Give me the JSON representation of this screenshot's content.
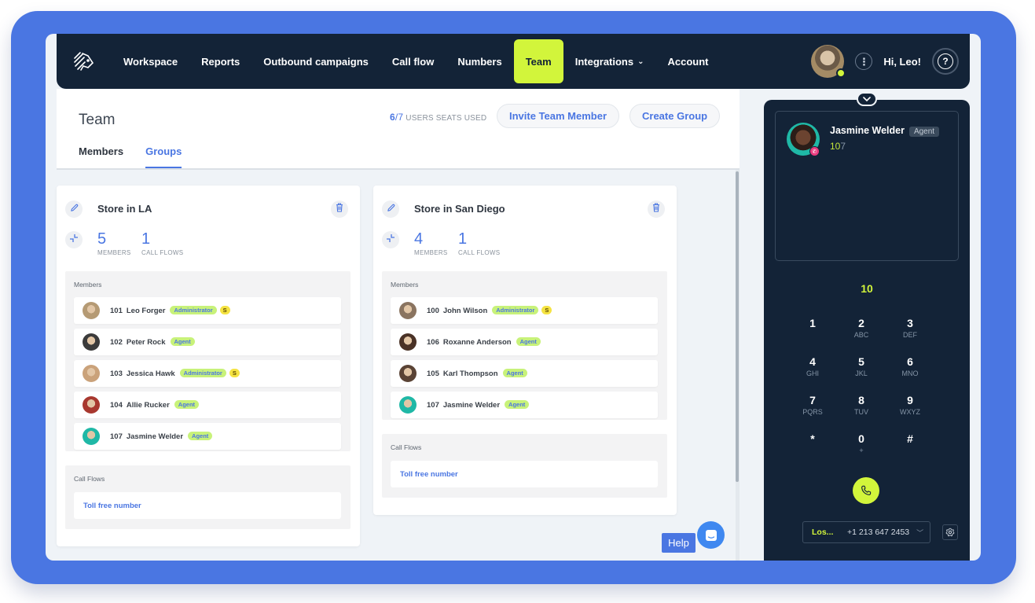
{
  "nav": {
    "logo": "brand-logo",
    "items": [
      {
        "label": "Workspace",
        "active": false
      },
      {
        "label": "Reports",
        "active": false
      },
      {
        "label": "Outbound campaigns",
        "active": false
      },
      {
        "label": "Call flow",
        "active": false
      },
      {
        "label": "Numbers",
        "active": false
      },
      {
        "label": "Team",
        "active": true
      },
      {
        "label": "Integrations",
        "active": false,
        "dropdown": true
      },
      {
        "label": "Account",
        "active": false
      }
    ],
    "greeting": "Hi, Leo!",
    "help_icon": "?",
    "kebab_icon": "⋮"
  },
  "header": {
    "title": "Team",
    "seats_used": "6",
    "seats_total": "/7",
    "seats_label": "USERS SEATS USED",
    "invite_label": "Invite Team Member",
    "create_label": "Create Group",
    "tabs": [
      {
        "label": "Members",
        "active": false
      },
      {
        "label": "Groups",
        "active": true
      }
    ]
  },
  "groups": [
    {
      "name": "Store in LA",
      "members_count": "5",
      "members_label": "MEMBERS",
      "flows_count": "1",
      "flows_label": "CALL FLOWS",
      "members_section_title": "Members",
      "members": [
        {
          "ext": "101",
          "name": "Leo Forger",
          "role": "Administrator",
          "s": "S",
          "color": "#b59a74"
        },
        {
          "ext": "102",
          "name": "Peter Rock",
          "role": "Agent",
          "s": "",
          "color": "#3b3b3b"
        },
        {
          "ext": "103",
          "name": "Jessica Hawk",
          "role": "Administrator",
          "s": "S",
          "color": "#caa27a"
        },
        {
          "ext": "104",
          "name": "Allie Rucker",
          "role": "Agent",
          "s": "",
          "color": "#a8382f"
        },
        {
          "ext": "107",
          "name": "Jasmine Welder",
          "role": "Agent",
          "s": "",
          "color": "#1fb8a6"
        }
      ],
      "flows_section_title": "Call Flows",
      "flows": [
        "Toll free number"
      ]
    },
    {
      "name": "Store in San Diego",
      "members_count": "4",
      "members_label": "MEMBERS",
      "flows_count": "1",
      "flows_label": "CALL FLOWS",
      "members_section_title": "Members",
      "members": [
        {
          "ext": "100",
          "name": "John Wilson",
          "role": "Administrator",
          "s": "S",
          "color": "#8a7460"
        },
        {
          "ext": "106",
          "name": "Roxanne Anderson",
          "role": "Agent",
          "s": "",
          "color": "#4a3226"
        },
        {
          "ext": "105",
          "name": "Karl Thompson",
          "role": "Agent",
          "s": "",
          "color": "#5a4335"
        },
        {
          "ext": "107",
          "name": "Jasmine Welder",
          "role": "Agent",
          "s": "",
          "color": "#1fb8a6"
        }
      ],
      "flows_section_title": "Call Flows",
      "flows": [
        "Toll free number"
      ]
    }
  ],
  "help": {
    "label": "Help"
  },
  "dialer": {
    "contact": {
      "name": "Jasmine Welder",
      "role": "Agent",
      "ext_match": "10",
      "ext_rest": "7"
    },
    "input": "10",
    "keys": [
      {
        "d": "1",
        "l": ""
      },
      {
        "d": "2",
        "l": "ABC"
      },
      {
        "d": "3",
        "l": "DEF"
      },
      {
        "d": "4",
        "l": "GHI"
      },
      {
        "d": "5",
        "l": "JKL"
      },
      {
        "d": "6",
        "l": "MNO"
      },
      {
        "d": "7",
        "l": "PQRS"
      },
      {
        "d": "8",
        "l": "TUV"
      },
      {
        "d": "9",
        "l": "WXYZ"
      },
      {
        "d": "*",
        "l": ""
      },
      {
        "d": "0",
        "l": "+"
      },
      {
        "d": "#",
        "l": ""
      }
    ],
    "caller_location": "Los...",
    "caller_number": "+1 213 647 2453"
  },
  "colors": {
    "accent_blue": "#4a76e2",
    "lime": "#d2f53b",
    "navy": "#132337"
  }
}
